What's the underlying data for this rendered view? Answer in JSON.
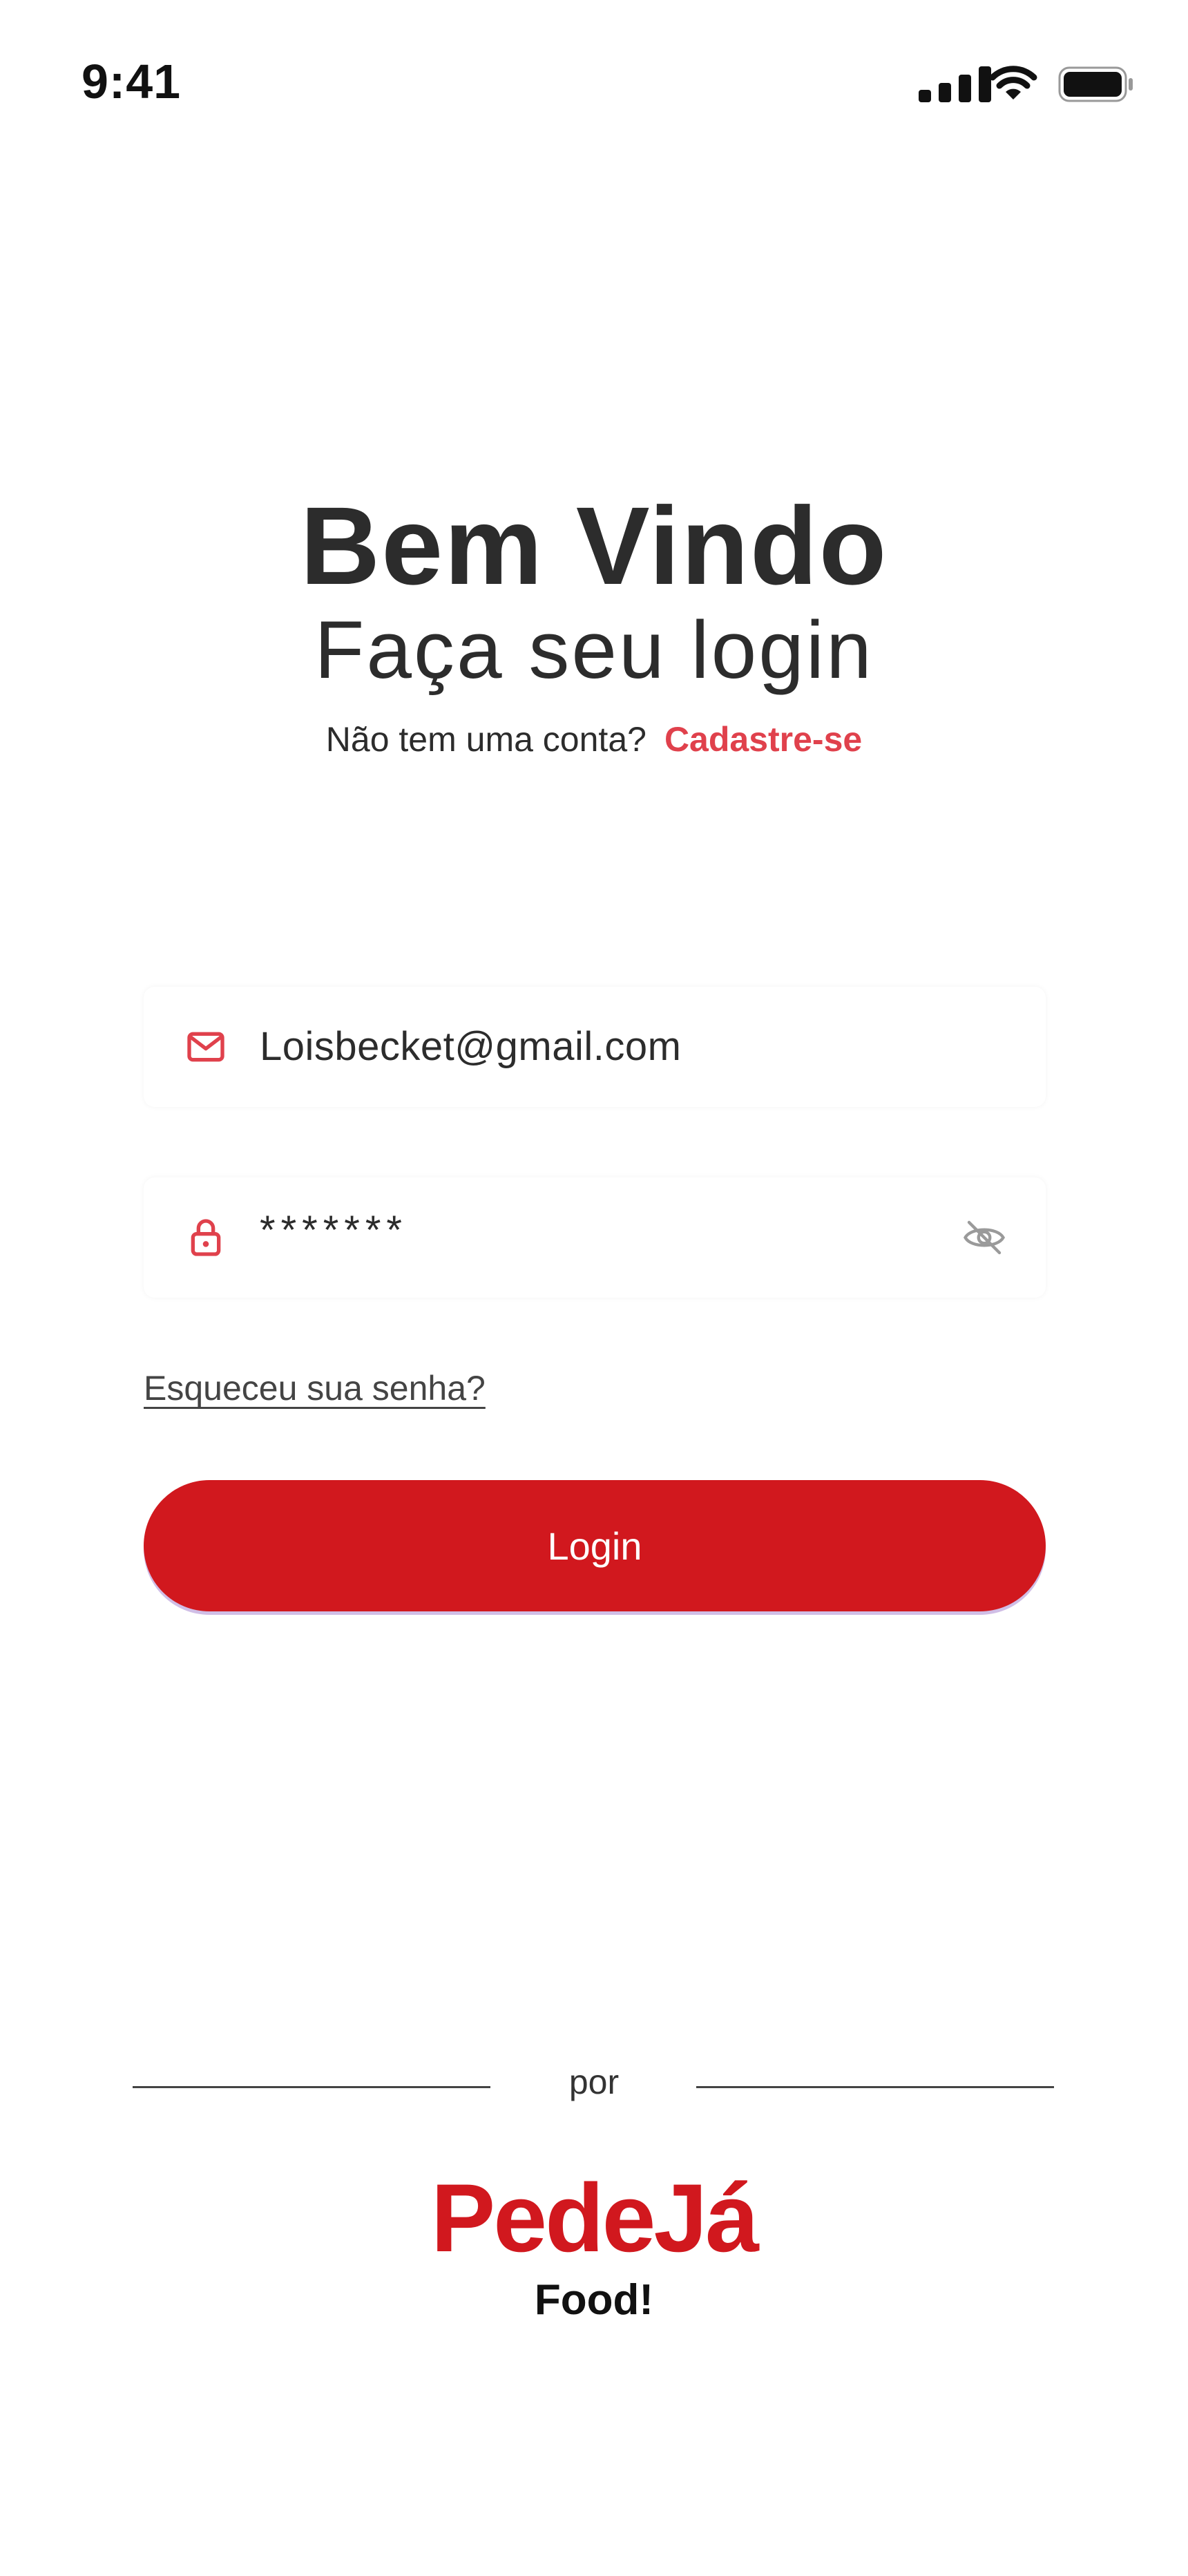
{
  "status_bar": {
    "time": "9:41"
  },
  "header": {
    "title": "Bem Vindo",
    "subtitle": "Faça seu login",
    "no_account_text": "Não tem uma conta?",
    "signup_link": "Cadastre-se"
  },
  "form": {
    "email_value": "Loisbecket@gmail.com",
    "password_value": "*******",
    "forgot_password": "Esqueceu sua senha?",
    "login_button": "Login"
  },
  "footer": {
    "by_label": "por",
    "brand_name": "PedeJá",
    "brand_tagline": "Food!"
  },
  "colors": {
    "accent": "#d1181e",
    "link": "#e0414c",
    "text": "#2c2c2c"
  },
  "icons": {
    "email": "mail-icon",
    "password": "lock-icon",
    "visibility": "eye-off-icon"
  }
}
